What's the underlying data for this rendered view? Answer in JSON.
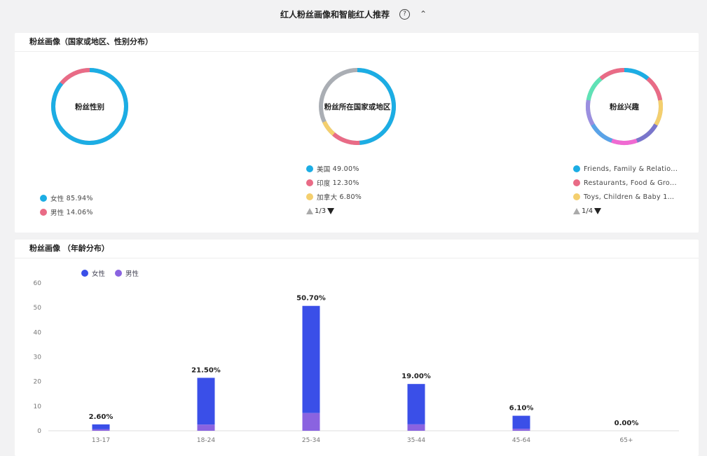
{
  "header": {
    "title": "红人粉丝画像和智能红人推荐",
    "help": "?",
    "caret": "^"
  },
  "profile_card": {
    "title": "粉丝画像（国家或地区、性别分布）",
    "gender": {
      "label": "粉丝性别",
      "legend": [
        {
          "name": "女性",
          "value": "85.94%",
          "color": "#1cade4"
        },
        {
          "name": "男性",
          "value": "14.06%",
          "color": "#e96b86"
        }
      ]
    },
    "country": {
      "label": "粉丝所在国家或地区",
      "legend": [
        {
          "name": "美国",
          "value": "49.00%",
          "color": "#1cade4"
        },
        {
          "name": "印度",
          "value": "12.30%",
          "color": "#e96b86"
        },
        {
          "name": "加拿大",
          "value": "6.80%",
          "color": "#f4cf6e"
        }
      ],
      "page": "1/3"
    },
    "interest": {
      "label": "粉丝兴趣",
      "legend": [
        {
          "name": "Friends, Family & Relatio...",
          "color": "#1cade4"
        },
        {
          "name": "Restaurants, Food & Gro...",
          "color": "#e96b86"
        },
        {
          "name": "Toys, Children & Baby 10...",
          "color": "#f4cf6e"
        }
      ],
      "page": "1/4"
    }
  },
  "age_card": {
    "title": "粉丝画像 （年龄分布）",
    "legend": [
      {
        "name": "女性",
        "color": "#3a4fe8"
      },
      {
        "name": "男性",
        "color": "#8a63e0"
      }
    ]
  },
  "chart_data": [
    {
      "type": "pie",
      "label": "粉丝性别",
      "categories": [
        "女性",
        "男性"
      ],
      "values": [
        85.94,
        14.06
      ],
      "colors": [
        "#1cade4",
        "#e96b86"
      ]
    },
    {
      "type": "pie",
      "label": "粉丝所在国家或地区",
      "categories": [
        "美国",
        "印度",
        "加拿大"
      ],
      "values": [
        49.0,
        12.3,
        6.8
      ],
      "colors": [
        "#1cade4",
        "#e96b86",
        "#f4cf6e"
      ]
    },
    {
      "type": "pie",
      "label": "粉丝兴趣",
      "categories": [
        "Friends, Family & Relatio...",
        "Restaurants, Food & Gro...",
        "Toys, Children & Baby 10..."
      ]
    },
    {
      "type": "bar",
      "categories": [
        "13-17",
        "18-24",
        "25-34",
        "35-44",
        "45-64",
        "65+"
      ],
      "series": [
        {
          "name": "女性",
          "values": [
            2.0,
            19.0,
            43.5,
            16.4,
            5.3,
            0.0
          ],
          "color": "#3a4fe8"
        },
        {
          "name": "男性",
          "values": [
            0.6,
            2.5,
            7.2,
            2.6,
            0.8,
            0.0
          ],
          "color": "#8a63e0"
        }
      ],
      "data_labels": [
        "2.60%",
        "21.50%",
        "50.70%",
        "19.00%",
        "6.10%",
        "0.00%"
      ],
      "ylim": [
        0,
        60
      ],
      "yticks": [
        0,
        10,
        20,
        30,
        40,
        50,
        60
      ],
      "grid": false,
      "legend": "top-left"
    }
  ]
}
